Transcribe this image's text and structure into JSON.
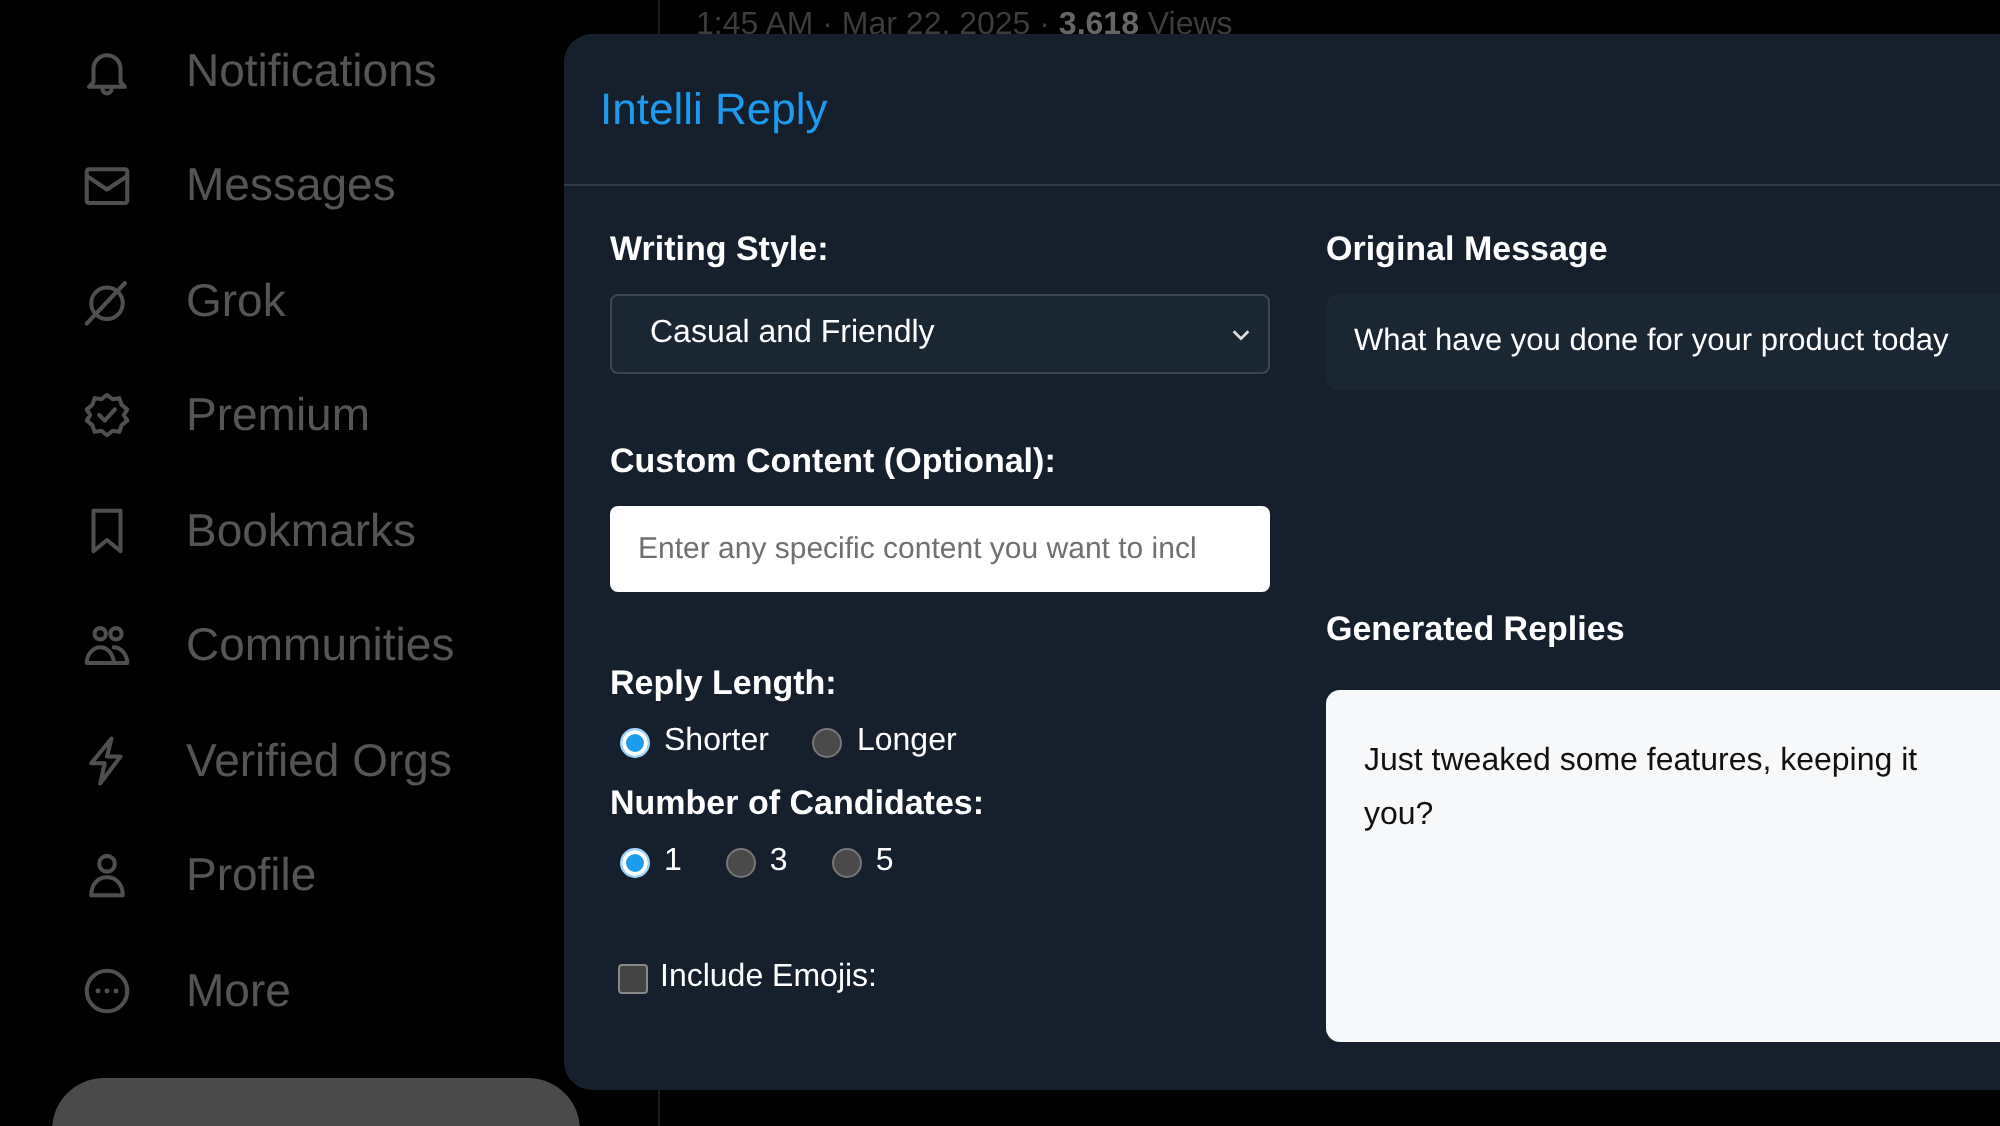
{
  "sidebar": {
    "items": [
      {
        "label": "Notifications"
      },
      {
        "label": "Messages"
      },
      {
        "label": "Grok"
      },
      {
        "label": "Premium"
      },
      {
        "label": "Bookmarks"
      },
      {
        "label": "Communities"
      },
      {
        "label": "Verified Orgs"
      },
      {
        "label": "Profile"
      },
      {
        "label": "More"
      }
    ]
  },
  "post_meta": "1:45 AM · Mar 22, 2025 · **3,618** Views",
  "dialog": {
    "title": "Intelli Reply",
    "writing_style": {
      "label": "Writing Style:",
      "value": "Casual and Friendly"
    },
    "custom_content": {
      "label": "Custom Content (Optional):",
      "placeholder": "Enter any specific content you want to incl"
    },
    "reply_length": {
      "label": "Reply Length:",
      "options": [
        {
          "label": "Shorter",
          "selected": true
        },
        {
          "label": "Longer",
          "selected": false
        }
      ]
    },
    "candidates": {
      "label": "Number of Candidates:",
      "options": [
        {
          "label": "1",
          "selected": true
        },
        {
          "label": "3",
          "selected": false
        },
        {
          "label": "5",
          "selected": false
        }
      ]
    },
    "include_emojis": {
      "label": "Include Emojis:",
      "checked": false
    },
    "original_message": {
      "label": "Original Message",
      "text": "What have you done for your product today"
    },
    "generated_replies": {
      "label": "Generated Replies",
      "lines": [
        "Just tweaked some features, keeping it",
        "you?"
      ]
    }
  }
}
